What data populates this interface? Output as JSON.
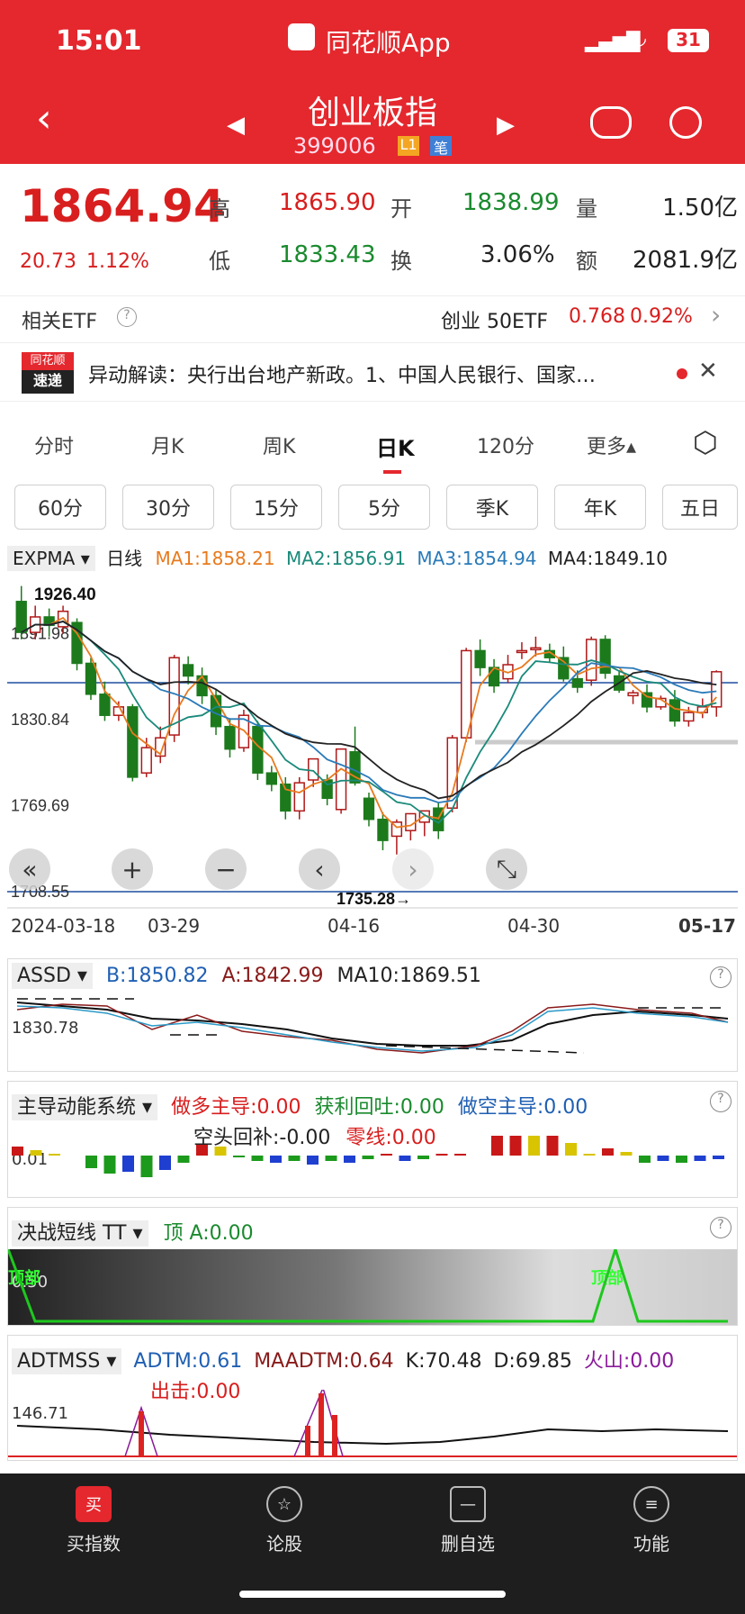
{
  "status_bar": {
    "time": "15:01",
    "app": "同花顺App",
    "battery": "31"
  },
  "header": {
    "title": "创业板指",
    "code": "399006",
    "badge_l1": "L1",
    "badge_note": "笔"
  },
  "quote": {
    "price": "1864.94",
    "change": "20.73",
    "change_pct": "1.12%",
    "high_label": "高",
    "high": "1865.90",
    "open_label": "开",
    "open": "1838.99",
    "vol_label": "量",
    "vol": "1.50亿",
    "low_label": "低",
    "low": "1833.43",
    "turnover_label": "换",
    "turnover": "3.06%",
    "amount_label": "额",
    "amount": "2081.9亿"
  },
  "etf": {
    "label": "相关ETF",
    "name": "创业 50ETF",
    "price": "0.768",
    "pct": "0.92%"
  },
  "news": {
    "logo_top": "同花顺",
    "logo_bottom": "速递",
    "text": "异动解读：央行出台地产新政。1、中国人民银行、国家…"
  },
  "tabs": [
    "分时",
    "月K",
    "周K",
    "日K",
    "120分",
    "更多▴"
  ],
  "period_buttons": [
    "60分",
    "30分",
    "15分",
    "5分",
    "季K",
    "年K",
    "五日"
  ],
  "main_chart": {
    "indicator": "EXPMA",
    "period": "日线",
    "ma1": "MA1:1858.21",
    "ma2": "MA2:1856.91",
    "ma3": "MA3:1854.94",
    "ma4": "MA4:1849.10",
    "max_label": "1926.40",
    "min_label": "1735.28→",
    "yticks": [
      "1891.98",
      "1830.84",
      "1769.69",
      "1708.55"
    ],
    "xticks": [
      "2024-03-18",
      "03-29",
      "04-16",
      "04-30",
      "05-17"
    ],
    "colors": {
      "up": "#b01818",
      "down": "#1c7a1c",
      "ma1": "#e87a1e",
      "ma2": "#1a8a7a",
      "ma3": "#2a7ab8",
      "ma4": "#222222"
    }
  },
  "chart_data": {
    "type": "candlestick",
    "ylim": [
      1708.55,
      1926.4
    ],
    "candles": [
      {
        "o": 1915,
        "h": 1926,
        "c": 1893,
        "l": 1888
      },
      {
        "o": 1893,
        "h": 1912,
        "c": 1904,
        "l": 1888
      },
      {
        "o": 1904,
        "h": 1910,
        "c": 1898,
        "l": 1890
      },
      {
        "o": 1897,
        "h": 1912,
        "c": 1908,
        "l": 1892
      },
      {
        "o": 1900,
        "h": 1903,
        "c": 1871,
        "l": 1866
      },
      {
        "o": 1871,
        "h": 1875,
        "c": 1849,
        "l": 1845
      },
      {
        "o": 1849,
        "h": 1858,
        "c": 1834,
        "l": 1830
      },
      {
        "o": 1834,
        "h": 1844,
        "c": 1840,
        "l": 1830
      },
      {
        "o": 1840,
        "h": 1842,
        "c": 1790,
        "l": 1787
      },
      {
        "o": 1793,
        "h": 1818,
        "c": 1811,
        "l": 1790
      },
      {
        "o": 1805,
        "h": 1826,
        "c": 1818,
        "l": 1800
      },
      {
        "o": 1820,
        "h": 1877,
        "c": 1875,
        "l": 1815
      },
      {
        "o": 1870,
        "h": 1876,
        "c": 1862,
        "l": 1856
      },
      {
        "o": 1862,
        "h": 1868,
        "c": 1848,
        "l": 1842
      },
      {
        "o": 1848,
        "h": 1852,
        "c": 1826,
        "l": 1820
      },
      {
        "o": 1826,
        "h": 1832,
        "c": 1810,
        "l": 1804
      },
      {
        "o": 1811,
        "h": 1838,
        "c": 1834,
        "l": 1808
      },
      {
        "o": 1826,
        "h": 1830,
        "c": 1793,
        "l": 1788
      },
      {
        "o": 1793,
        "h": 1798,
        "c": 1785,
        "l": 1780
      },
      {
        "o": 1785,
        "h": 1790,
        "c": 1766,
        "l": 1760
      },
      {
        "o": 1766,
        "h": 1790,
        "c": 1786,
        "l": 1760
      },
      {
        "o": 1788,
        "h": 1800,
        "c": 1803,
        "l": 1783
      },
      {
        "o": 1788,
        "h": 1792,
        "c": 1775,
        "l": 1770
      },
      {
        "o": 1767,
        "h": 1810,
        "c": 1810,
        "l": 1764
      },
      {
        "o": 1808,
        "h": 1826,
        "c": 1786,
        "l": 1784
      },
      {
        "o": 1775,
        "h": 1779,
        "c": 1760,
        "l": 1755
      },
      {
        "o": 1760,
        "h": 1765,
        "c": 1745,
        "l": 1738
      },
      {
        "o": 1748,
        "h": 1760,
        "c": 1758,
        "l": 1735
      },
      {
        "o": 1752,
        "h": 1760,
        "c": 1764,
        "l": 1745
      },
      {
        "o": 1758,
        "h": 1766,
        "c": 1766,
        "l": 1748
      },
      {
        "o": 1768,
        "h": 1772,
        "c": 1752,
        "l": 1746
      },
      {
        "o": 1768,
        "h": 1820,
        "c": 1818,
        "l": 1765
      },
      {
        "o": 1818,
        "h": 1882,
        "c": 1880,
        "l": 1815
      },
      {
        "o": 1880,
        "h": 1888,
        "c": 1868,
        "l": 1862
      },
      {
        "o": 1868,
        "h": 1874,
        "c": 1855,
        "l": 1850
      },
      {
        "o": 1860,
        "h": 1877,
        "c": 1870,
        "l": 1857
      },
      {
        "o": 1880,
        "h": 1886,
        "c": 1880,
        "l": 1874
      },
      {
        "o": 1882,
        "h": 1890,
        "c": 1882,
        "l": 1876
      },
      {
        "o": 1880,
        "h": 1885,
        "c": 1875,
        "l": 1872
      },
      {
        "o": 1875,
        "h": 1883,
        "c": 1860,
        "l": 1858
      },
      {
        "o": 1860,
        "h": 1866,
        "c": 1854,
        "l": 1850
      },
      {
        "o": 1859,
        "h": 1890,
        "c": 1888,
        "l": 1855
      },
      {
        "o": 1888,
        "h": 1891,
        "c": 1864,
        "l": 1860
      },
      {
        "o": 1862,
        "h": 1866,
        "c": 1852,
        "l": 1850
      },
      {
        "o": 1848,
        "h": 1852,
        "c": 1850,
        "l": 1842
      },
      {
        "o": 1850,
        "h": 1856,
        "c": 1840,
        "l": 1836
      },
      {
        "o": 1840,
        "h": 1848,
        "c": 1846,
        "l": 1838
      },
      {
        "o": 1845,
        "h": 1852,
        "c": 1830,
        "l": 1826
      },
      {
        "o": 1830,
        "h": 1840,
        "c": 1836,
        "l": 1826
      },
      {
        "o": 1836,
        "h": 1846,
        "c": 1840,
        "l": 1832
      },
      {
        "o": 1840,
        "h": 1866,
        "c": 1865,
        "l": 1833
      }
    ]
  },
  "assd": {
    "name": "ASSD",
    "b": "B:1850.82",
    "a": "A:1842.99",
    "ma10": "MA10:1869.51",
    "tick": "1830.78"
  },
  "zhudao": {
    "name": "主导动能系统",
    "l1": "做多主导:0.00",
    "l2": "获利回吐:0.00",
    "l3": "做空主导:0.00",
    "l4": "空头回补:-0.00",
    "l5": "零线:0.00",
    "tick": "0.01"
  },
  "juezhan": {
    "name": "决战短线 TT",
    "top": "顶 A:0.00",
    "tick": "0.50",
    "mark": "顶部"
  },
  "adtm": {
    "name": "ADTMSS",
    "adtm": "ADTM:0.61",
    "maadtm": "MAADTM:0.64",
    "k": "K:70.48",
    "d": "D:69.85",
    "vol": "火山:0.00",
    "hit": "出击:0.00",
    "tick": "146.71"
  },
  "nav": [
    "买指数",
    "论股",
    "删自选",
    "功能"
  ],
  "nav_icons": [
    "买",
    "☆",
    "—",
    "≡"
  ]
}
